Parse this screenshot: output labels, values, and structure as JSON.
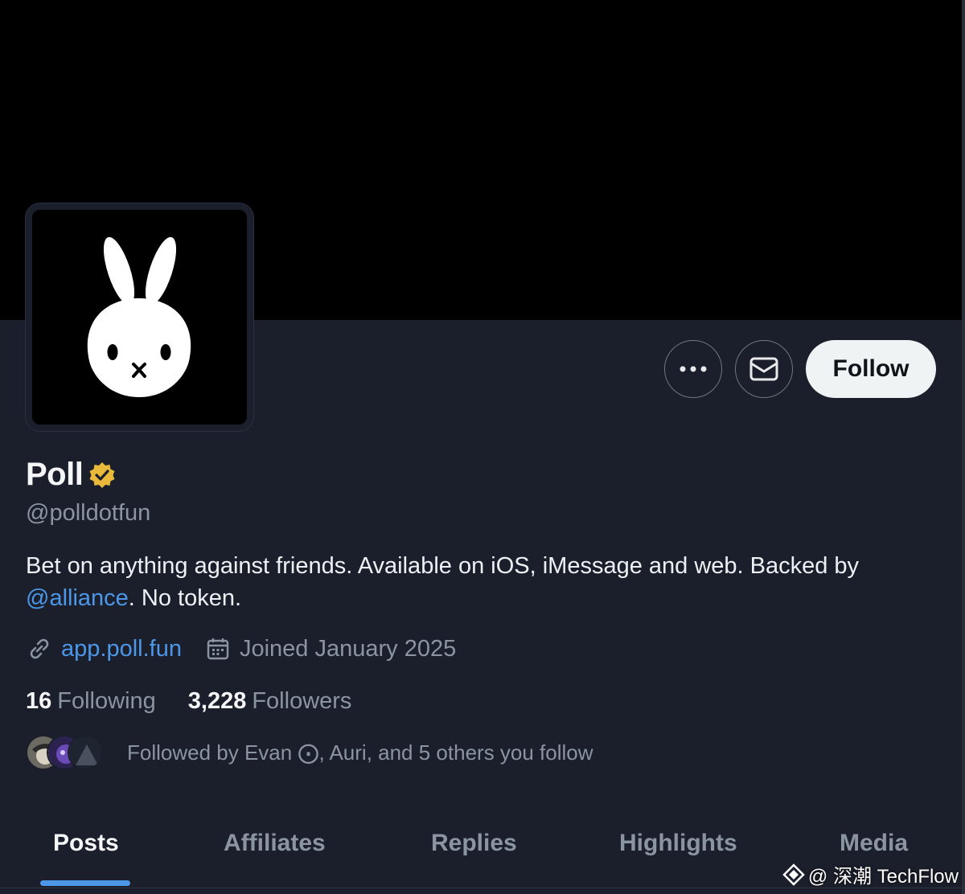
{
  "profile": {
    "display_name": "Poll",
    "handle": "@polldotfun",
    "bio_text": "Bet on anything against friends. Available on iOS, iMessage and web. Backed by ",
    "bio_mention": "@alliance",
    "bio_tail": ". No token.",
    "website": "app.poll.fun",
    "joined": "Joined January 2025",
    "following_count": "16",
    "following_label": "Following",
    "followers_count": "3,228",
    "followers_label": "Followers",
    "followed_by": "Followed by Evan ⨀, Auri, and 5 others you follow"
  },
  "actions": {
    "follow_label": "Follow"
  },
  "tabs": [
    {
      "label": "Posts",
      "active": true
    },
    {
      "label": "Affiliates",
      "active": false
    },
    {
      "label": "Replies",
      "active": false
    },
    {
      "label": "Highlights",
      "active": false
    },
    {
      "label": "Media",
      "active": false
    }
  ],
  "watermark": "@ 深潮 TechFlow",
  "colors": {
    "accent": "#4c97e8",
    "background": "#1b1f2b",
    "banner": "#000000",
    "verified_badge": "#e8b93a",
    "follow_button_bg": "#eff3f4"
  },
  "icons": {
    "avatar": "white-rabbit-icon",
    "more": "more-dots-icon",
    "message": "envelope-icon",
    "verified": "verified-badge-icon",
    "link": "link-icon",
    "calendar": "calendar-icon"
  }
}
